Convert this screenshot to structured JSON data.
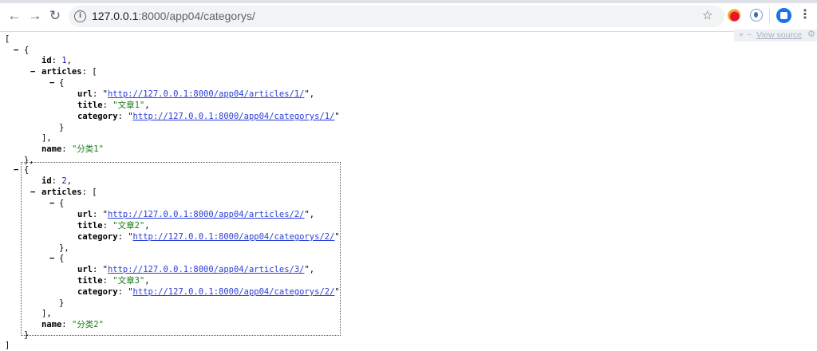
{
  "browser": {
    "url_host": "127.0.0.1",
    "url_rest": ":8000/app04/categorys/"
  },
  "json_viewer": {
    "plus": "+",
    "minus": "−",
    "view_source": "View source"
  },
  "glyphs": {
    "toggle": "−",
    "open_bracket": "[",
    "close_bracket": "]",
    "open_brace": "{",
    "close_brace": "}",
    "close_brace_comma": "},",
    "close_bracket_comma": "],"
  },
  "categories": [
    {
      "id": "1",
      "name": "分类1",
      "articles": [
        {
          "url": "http://127.0.0.1:8000/app04/articles/1/",
          "title": "文章1",
          "category": "http://127.0.0.1:8000/app04/categorys/1/"
        }
      ]
    },
    {
      "id": "2",
      "name": "分类2",
      "articles": [
        {
          "url": "http://127.0.0.1:8000/app04/articles/2/",
          "title": "文章2",
          "category": "http://127.0.0.1:8000/app04/categorys/2/"
        },
        {
          "url": "http://127.0.0.1:8000/app04/articles/3/",
          "title": "文章3",
          "category": "http://127.0.0.1:8000/app04/categorys/2/"
        }
      ]
    }
  ]
}
